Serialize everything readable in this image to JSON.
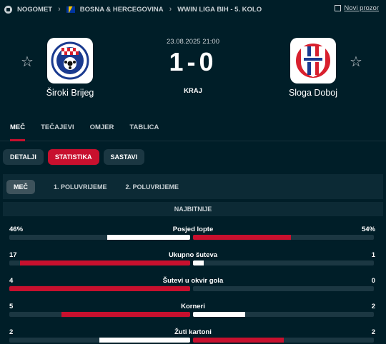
{
  "breadcrumb": {
    "sport": "NOGOMET",
    "country": "BOSNA & HERCEGOVINA",
    "league": "WWIN LIGA BIH - 5. KOLO"
  },
  "new_window": "Novi prozor",
  "match": {
    "datetime": "23.08.2025 21:00",
    "score": "1-0",
    "status": "KRAJ",
    "home": {
      "name": "Široki Brijeg"
    },
    "away": {
      "name": "Sloga Doboj"
    }
  },
  "tabs": [
    "MEČ",
    "TEČAJEVI",
    "OMJER",
    "TABLICA"
  ],
  "subtabs": [
    "DETALJI",
    "STATISTIKA",
    "SASTAVI"
  ],
  "periods": [
    "MEČ",
    "1. POLUVRIJEME",
    "2. POLUVRIJEME"
  ],
  "section": "NAJBITNIJE",
  "colors": {
    "home": "#c8102e",
    "away": "#ffffff",
    "accent": "#c8102e",
    "background": "#001e28"
  },
  "stats": [
    {
      "label": "Posjed lopte",
      "home": "46%",
      "away": "54%",
      "home_share": 0.46,
      "away_share": 0.54,
      "home_leads": false
    },
    {
      "label": "Ukupno šuteva",
      "home": "17",
      "away": "1",
      "home_share": 0.94,
      "away_share": 0.06,
      "home_leads": true
    },
    {
      "label": "Šutevi u okvir gola",
      "home": "4",
      "away": "0",
      "home_share": 1.0,
      "away_share": 0.0,
      "home_leads": true
    },
    {
      "label": "Korneri",
      "home": "5",
      "away": "2",
      "home_share": 0.71,
      "away_share": 0.29,
      "home_leads": true
    },
    {
      "label": "Žuti kartoni",
      "home": "2",
      "away": "2",
      "home_share": 0.5,
      "away_share": 0.5,
      "home_leads": false
    }
  ]
}
